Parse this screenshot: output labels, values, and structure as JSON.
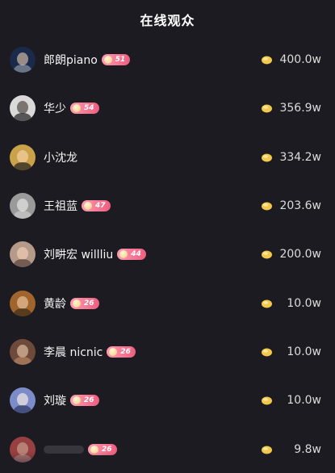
{
  "header": {
    "title": "在线观众"
  },
  "viewers": [
    {
      "name": "郎朗piano",
      "level": "51",
      "amount": "400.0w",
      "avatar_color": "#1b2a4a"
    },
    {
      "name": "华少",
      "level": "54",
      "amount": "356.9w",
      "avatar_color": "#d9d9d9"
    },
    {
      "name": "小沈龙",
      "level": "",
      "amount": "334.2w",
      "avatar_color": "#c9a24a"
    },
    {
      "name": "王祖蓝",
      "level": "47",
      "amount": "203.6w",
      "avatar_color": "#9a9a9a"
    },
    {
      "name": "刘畊宏 willliu",
      "level": "44",
      "amount": "200.0w",
      "avatar_color": "#b59a8a"
    },
    {
      "name": "黄龄",
      "level": "26",
      "amount": "10.0w",
      "avatar_color": "#a0642c"
    },
    {
      "name": "李晨 nicnic",
      "level": "26",
      "amount": "10.0w",
      "avatar_color": "#6e4a3a"
    },
    {
      "name": "刘璇",
      "level": "26",
      "amount": "10.0w",
      "avatar_color": "#7b8cc8"
    },
    {
      "name": "",
      "level": "26",
      "amount": "9.8w",
      "avatar_color": "#b84a4a"
    }
  ],
  "colors": {
    "background": "#1c1b21",
    "badge": "#ee5d7f",
    "coin": "#f2c94c"
  }
}
